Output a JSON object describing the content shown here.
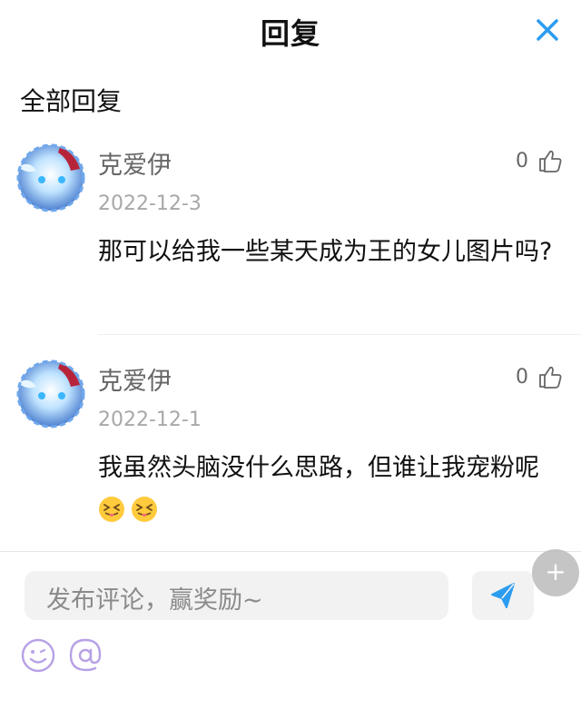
{
  "header": {
    "title": "回复"
  },
  "section": {
    "title": "全部回复"
  },
  "comments": [
    {
      "username": "克爱伊",
      "date": "2022-12-3",
      "likes": "0",
      "text": "那可以给我一些某天成为王的女儿图片吗?"
    },
    {
      "username": "克爱伊",
      "date": "2022-12-1",
      "likes": "0",
      "text": "我虽然头脑没什么思路，但谁让我宠粉呢"
    }
  ],
  "composer": {
    "placeholder": "发布评论，赢奖励~"
  },
  "icons": {
    "close": "close-icon",
    "like": "thumbs-up-icon",
    "send": "send-icon",
    "emoji": "smiley-icon",
    "mention": "at-icon",
    "fab": "plus-icon"
  },
  "colors": {
    "accent": "#2c9cf0",
    "emoji_tool": "#b7a1e6",
    "text": "#111111",
    "muted": "#a8a8a8"
  }
}
